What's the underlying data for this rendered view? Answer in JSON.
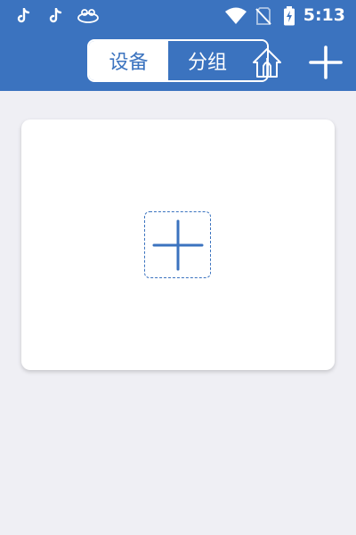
{
  "status_bar": {
    "time": "5:13",
    "icons": [
      "tiktok-icon",
      "tiktok-icon",
      "app-notification-icon",
      "wifi-icon",
      "no-sim-icon",
      "battery-charging-icon"
    ]
  },
  "header": {
    "tabs": [
      {
        "label": "设备",
        "active": true
      },
      {
        "label": "分组",
        "active": false
      }
    ],
    "home_icon": "home-icon",
    "add_icon": "plus-icon"
  },
  "main": {
    "add_tile_icon": "plus-icon"
  },
  "colors": {
    "accent": "#3b73bf",
    "background": "#efeff4",
    "card": "#ffffff"
  }
}
